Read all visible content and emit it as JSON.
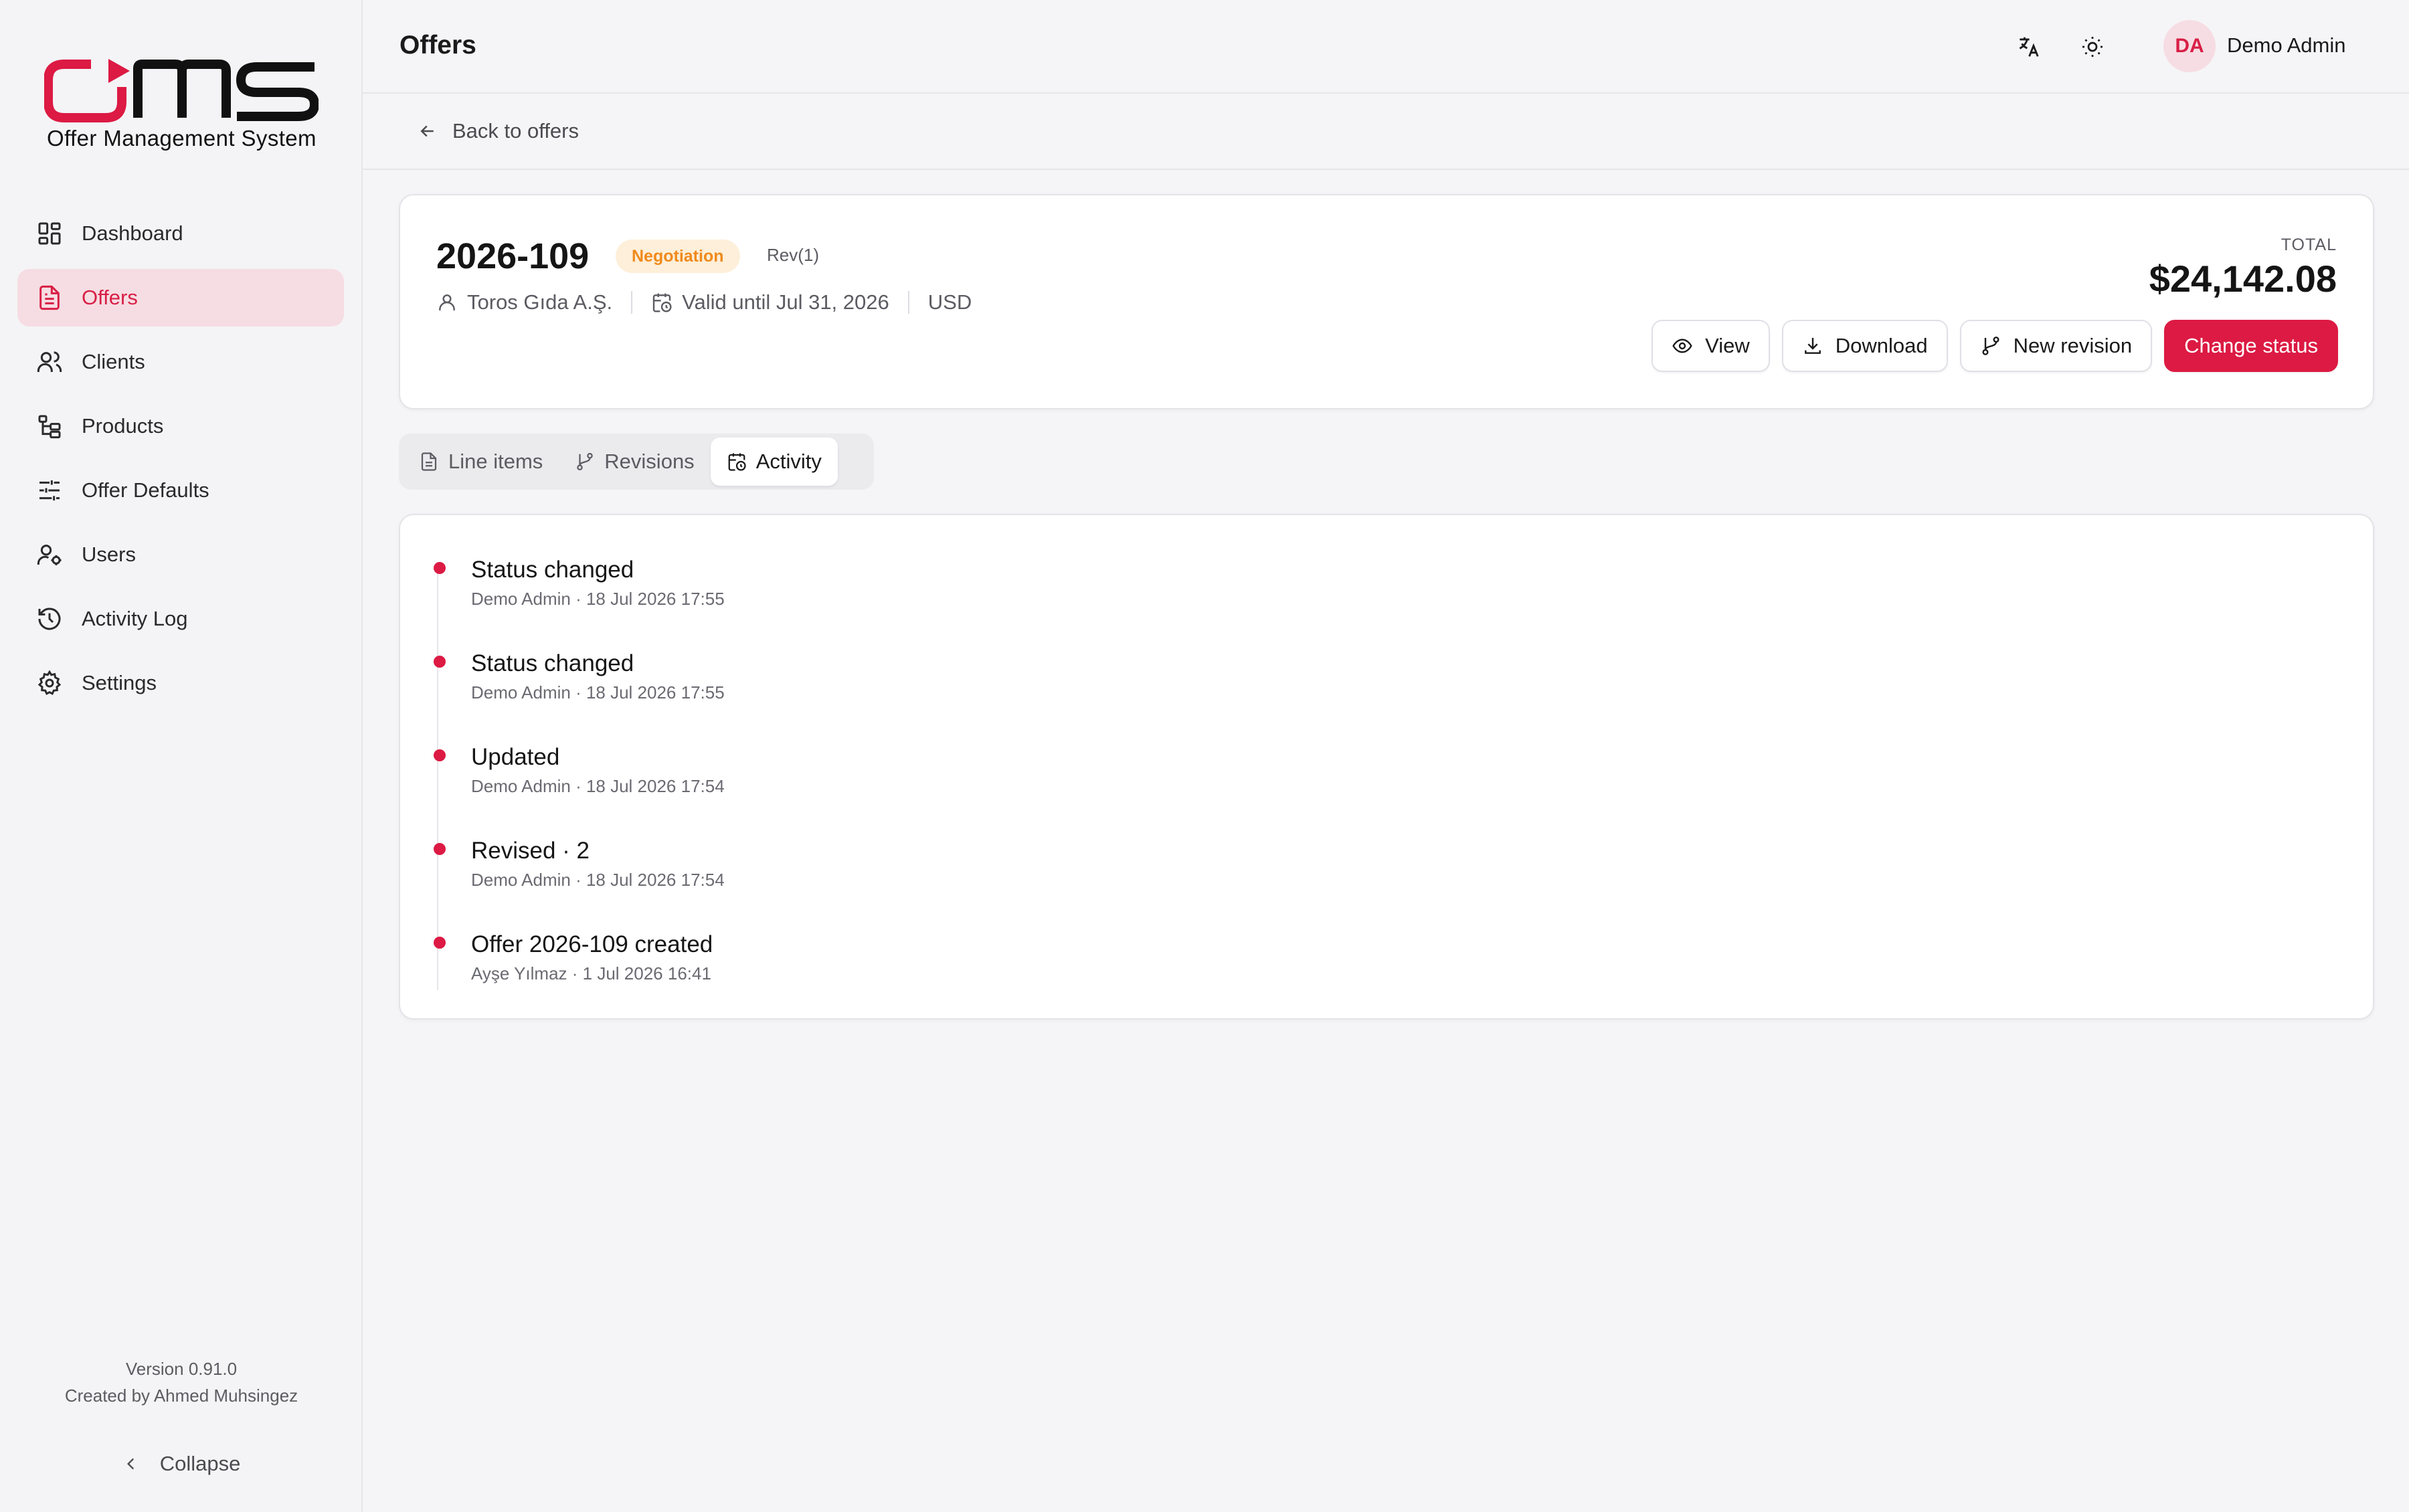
{
  "brand": {
    "logo_text": "OMS",
    "tagline": "Offer Management System",
    "accent": "#dc1a43"
  },
  "sidebar": {
    "items": [
      {
        "label": "Dashboard",
        "icon": "dashboard-icon"
      },
      {
        "label": "Offers",
        "icon": "document-icon",
        "active": true
      },
      {
        "label": "Clients",
        "icon": "users-icon"
      },
      {
        "label": "Products",
        "icon": "hierarchy-icon"
      },
      {
        "label": "Offer Defaults",
        "icon": "sliders-icon"
      },
      {
        "label": "Users",
        "icon": "user-cog-icon"
      },
      {
        "label": "Activity Log",
        "icon": "history-icon"
      },
      {
        "label": "Settings",
        "icon": "gear-icon"
      }
    ],
    "version": "Version 0.91.0",
    "credit": "Created by Ahmed Muhsingez",
    "collapse_label": "Collapse"
  },
  "header": {
    "title": "Offers",
    "user_initials": "DA",
    "user_name": "Demo Admin"
  },
  "subbar": {
    "back_label": "Back to offers"
  },
  "offer": {
    "number": "2026-109",
    "status": "Negotiation",
    "status_color": "#f08a1c",
    "revision": "Rev(1)",
    "client": "Toros Gıda A.Ş.",
    "valid_until": "Valid until Jul 31, 2026",
    "currency": "USD",
    "total_label": "TOTAL",
    "total_value": "$24,142.08",
    "actions": {
      "view": "View",
      "download": "Download",
      "new_revision": "New revision",
      "change_status": "Change status"
    }
  },
  "tabs": [
    {
      "label": "Line items",
      "icon": "document-icon"
    },
    {
      "label": "Revisions",
      "icon": "branch-icon"
    },
    {
      "label": "Activity",
      "icon": "calendar-clock-icon",
      "active": true
    }
  ],
  "activity": [
    {
      "title": "Status changed",
      "meta": "Demo Admin · 18 Jul 2026 17:55"
    },
    {
      "title": "Status changed",
      "meta": "Demo Admin · 18 Jul 2026 17:55"
    },
    {
      "title": "Updated",
      "meta": "Demo Admin · 18 Jul 2026 17:54"
    },
    {
      "title": "Revised · 2",
      "meta": "Demo Admin · 18 Jul 2026 17:54"
    },
    {
      "title": "Offer 2026-109 created",
      "meta": "Ayşe Yılmaz · 1 Jul 2026 16:41"
    }
  ]
}
